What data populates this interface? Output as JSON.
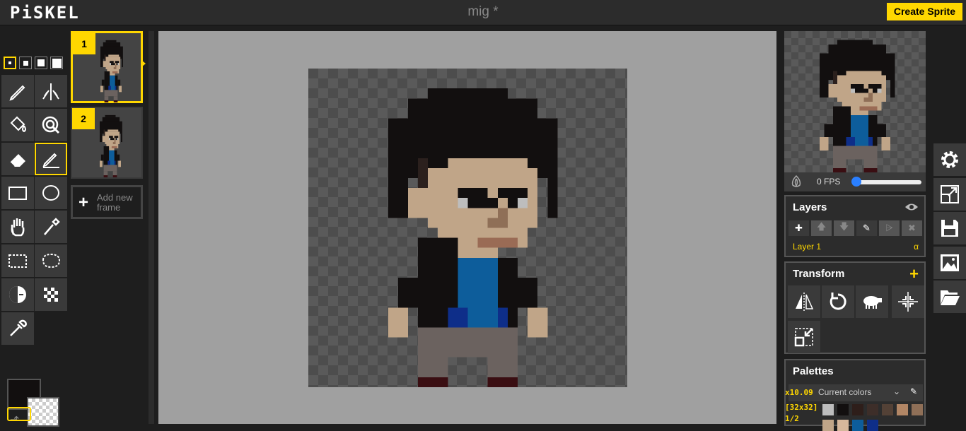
{
  "app": {
    "logo": "PiSKEL",
    "title": "mig *",
    "create_sprite": "Create Sprite"
  },
  "tools": {
    "pen_sizes": [
      "1",
      "2",
      "3",
      "4"
    ],
    "selected_pen_size": "1",
    "items": [
      "pen-icon",
      "vertical-mirror-pen-icon",
      "paint-bucket-icon",
      "paint-all-same-color-icon",
      "eraser-icon",
      "stroke-icon",
      "rectangle-icon",
      "circle-icon",
      "move-icon",
      "shape-select-icon",
      "rectangle-select-icon",
      "lasso-select-icon",
      "lighten-icon",
      "dithering-icon",
      "color-picker-icon"
    ],
    "selected_tool": "stroke-icon"
  },
  "colors": {
    "primary": "#120f0f",
    "secondary": "transparent"
  },
  "frames": {
    "items": [
      {
        "number": "1",
        "selected": true
      },
      {
        "number": "2",
        "selected": false
      }
    ],
    "add_label": "Add new frame"
  },
  "preview": {
    "fps": "0 FPS",
    "fps_value": 0
  },
  "layers": {
    "title": "Layers",
    "buttons": [
      "add-layer",
      "move-layer-up",
      "move-layer-down",
      "edit-layer",
      "merge-layer",
      "delete-layer"
    ],
    "items": [
      {
        "name": "Layer 1",
        "opacity_symbol": "α"
      }
    ]
  },
  "transform": {
    "title": "Transform",
    "tools": [
      "flip-icon",
      "rotate-icon",
      "clone-icon",
      "center-icon",
      "crop-icon"
    ]
  },
  "palettes": {
    "title": "Palettes",
    "selected": "Current colors",
    "swatches": [
      "#bdbdbd",
      "#120f0f",
      "#2e1e1a",
      "#3d2e29",
      "#534136",
      "#b28665",
      "#8f6f57",
      "#c0a588",
      "#d6b79b",
      "#0d5d9b",
      "#0e2e89"
    ]
  },
  "status": {
    "zoom": "x10.09",
    "size": "[32x32]",
    "frame": "1/2"
  },
  "sidebar_icons": [
    "settings-icon",
    "resize-icon",
    "save-icon",
    "export-icon",
    "import-icon"
  ]
}
